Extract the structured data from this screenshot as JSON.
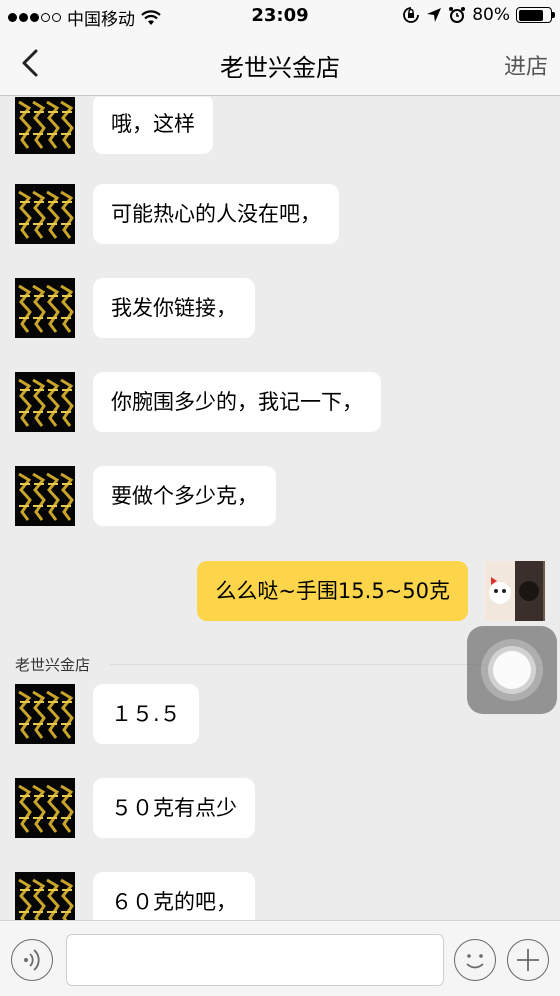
{
  "status": {
    "carrier": "中国移动",
    "time": "23:09",
    "battery": "80%",
    "battery_level": 0.8,
    "signal_bars": 3
  },
  "nav": {
    "title": "老世兴金店",
    "action": "进店",
    "back_icon": "chevron-left-icon"
  },
  "messages": [
    {
      "side": "left",
      "text": "哦，这样"
    },
    {
      "side": "left",
      "text": "可能热心的人没在吧，"
    },
    {
      "side": "left",
      "text": "我发你链接，"
    },
    {
      "side": "left",
      "text": "你腕围多少的，我记一下，"
    },
    {
      "side": "left",
      "text": "要做个多少克，"
    },
    {
      "side": "right",
      "text": "么么哒~手围15.5~50克"
    },
    {
      "side": "left",
      "text": "１５.５"
    },
    {
      "side": "left",
      "text": "５０克有点少"
    },
    {
      "side": "left",
      "text": "６０克的吧，"
    }
  ],
  "sender_label": "老世兴金店",
  "input": {
    "value": "",
    "placeholder": ""
  },
  "colors": {
    "my_bubble": "#fcd54a",
    "their_bubble": "#ffffff",
    "background": "#ececec"
  }
}
